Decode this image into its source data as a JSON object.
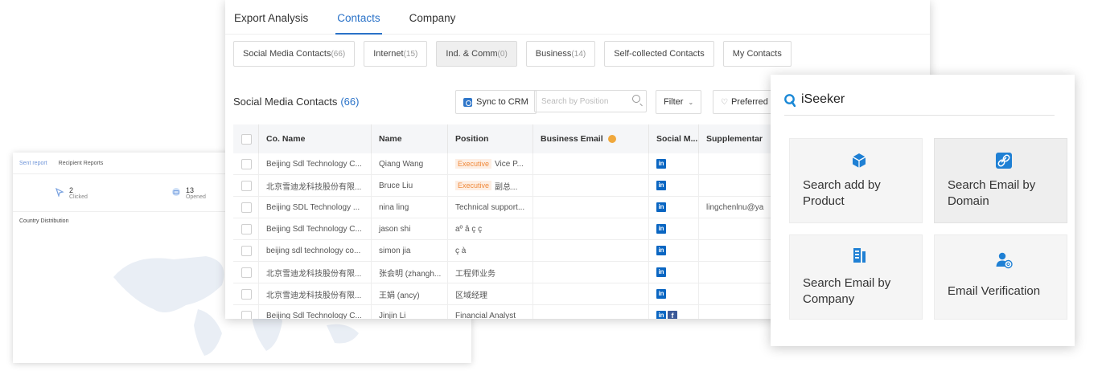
{
  "sent_report": {
    "tabs": [
      "Sent report",
      "Recipient Reports"
    ],
    "stats": [
      {
        "icon": "cursor-click-icon",
        "value": "2",
        "label": "Clicked"
      },
      {
        "icon": "envelope-open-icon",
        "value": "13",
        "label": "Opened"
      }
    ],
    "country_distribution_label": "Country Distribution"
  },
  "contacts": {
    "top_tabs": [
      "Export Analysis",
      "Contacts",
      "Company"
    ],
    "active_tab": "Contacts",
    "chips": [
      {
        "label": "Social Media Contacts",
        "count": "(66)"
      },
      {
        "label": "Internet",
        "count": "(15)"
      },
      {
        "label": "Ind. & Comm",
        "count": "(0)"
      },
      {
        "label": "Business",
        "count": "(14)"
      },
      {
        "label": "Self-collected Contacts",
        "count": ""
      },
      {
        "label": "My Contacts",
        "count": ""
      }
    ],
    "section_title": "Social Media Contacts",
    "section_count": "(66)",
    "sync_label": "Sync to CRM",
    "search_placeholder": "Search by Position",
    "filter_label": "Filter",
    "preferred_label": "Preferred",
    "columns": [
      "Co. Name",
      "Name",
      "Position",
      "Business Email",
      "Social M...",
      "Supplementar"
    ],
    "rows": [
      {
        "company": "Beijing Sdl Technology C...",
        "name": "Qiang Wang",
        "tag": "Executive",
        "position": "Vice P...",
        "social": [
          "linkedin"
        ],
        "extra": ""
      },
      {
        "company": "北京雪迪龙科技股份有限...",
        "name": "Bruce Liu",
        "tag": "Executive",
        "position": "副总...",
        "social": [
          "linkedin"
        ],
        "extra": ""
      },
      {
        "company": "Beijing SDL Technology ...",
        "name": "nina ling",
        "tag": "",
        "position": "Technical support...",
        "social": [
          "linkedin"
        ],
        "extra": "lingchenlnu@ya"
      },
      {
        "company": "Beijing Sdl Technology C...",
        "name": "jason shi",
        "tag": "",
        "position": "aº â ç ç",
        "social": [
          "linkedin"
        ],
        "extra": ""
      },
      {
        "company": "beijing sdl technology co...",
        "name": "simon jia",
        "tag": "",
        "position": "ç à",
        "social": [
          "linkedin"
        ],
        "extra": ""
      },
      {
        "company": "北京雪迪龙科技股份有限...",
        "name": "张会明 (zhangh...",
        "tag": "",
        "position": "工程师业务",
        "social": [
          "linkedin"
        ],
        "extra": ""
      },
      {
        "company": "北京雪迪龙科技股份有限...",
        "name": "王娟 (ancy)",
        "tag": "",
        "position": "区域经理",
        "social": [
          "linkedin"
        ],
        "extra": ""
      },
      {
        "company": "Beijing Sdl Technology C...",
        "name": "Jinjin Li",
        "tag": "",
        "position": "Financial Analyst",
        "social": [
          "linkedin",
          "facebook"
        ],
        "extra": ""
      }
    ]
  },
  "iseeker": {
    "title": "iSeeker",
    "tiles": [
      {
        "label": "Search add by Product",
        "icon": "cube-icon"
      },
      {
        "label": "Search Email by Domain",
        "icon": "link-icon"
      },
      {
        "label": "Search Email by Company",
        "icon": "building-icon"
      },
      {
        "label": "Email Verification",
        "icon": "user-email-icon"
      }
    ]
  },
  "colors": {
    "accent": "#2a72c8",
    "warning": "#f0a83c",
    "tag": "#f08a3c",
    "linkedin": "#0a66c2",
    "facebook": "#3b5998"
  }
}
